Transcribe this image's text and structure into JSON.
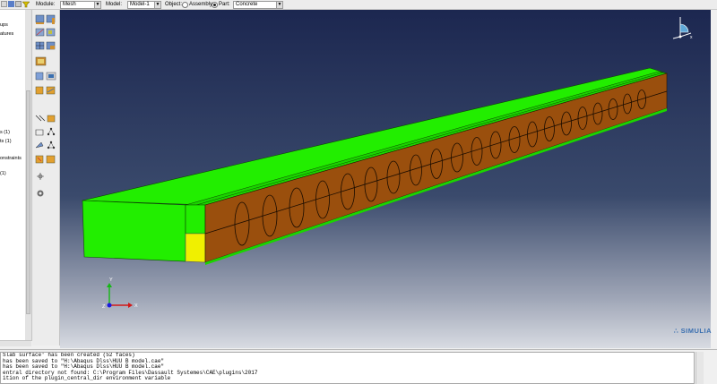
{
  "context_bar": {
    "module_label": "Module:",
    "module_value": "Mesh",
    "model_label": "Model:",
    "model_value": "Model-1",
    "object_label": "Object:",
    "assembly_label": "Assembly",
    "part_label": "Part:",
    "part_value": "Concrete",
    "selected_object": "Part"
  },
  "model_tree": {
    "items": [
      "ups",
      "atures",
      "s (1)",
      "ts (1)",
      "onstraints",
      "(1)"
    ]
  },
  "brand": {
    "text": "∴ SIMULIA"
  },
  "triad": {
    "x": "X",
    "y": "Y",
    "z": "Z"
  },
  "view_cube_label": "x",
  "messages": [
    "Slab surface' has been created (52 faces)",
    " has been saved to \"H:\\Abaqus Dlss\\HUU B model.cae\"",
    " has been saved to \"H:\\Abaqus Dlss\\HUU B model.cae\"",
    "entral directory not found: C:\\Program Files\\Dassault Systemes\\CAE\\plugins\\2017",
    "ition of the plugin_central_dir environment variable"
  ],
  "colors": {
    "slab_top": "#22ee00",
    "slab_side": "#9a4f0d",
    "slab_end": "#22ee00",
    "highlight": "#f0f000",
    "bg_top": "#1c2750",
    "bg_bottom": "#d8dbe2"
  },
  "icons": [
    "open-icon",
    "save-icon",
    "print-icon",
    "filter-icon",
    "mesh-seed-icon",
    "assign-element-icon",
    "mesh-part-icon",
    "verify-mesh-icon",
    "partition-icon",
    "virtual-topology-icon",
    "query-icon"
  ]
}
